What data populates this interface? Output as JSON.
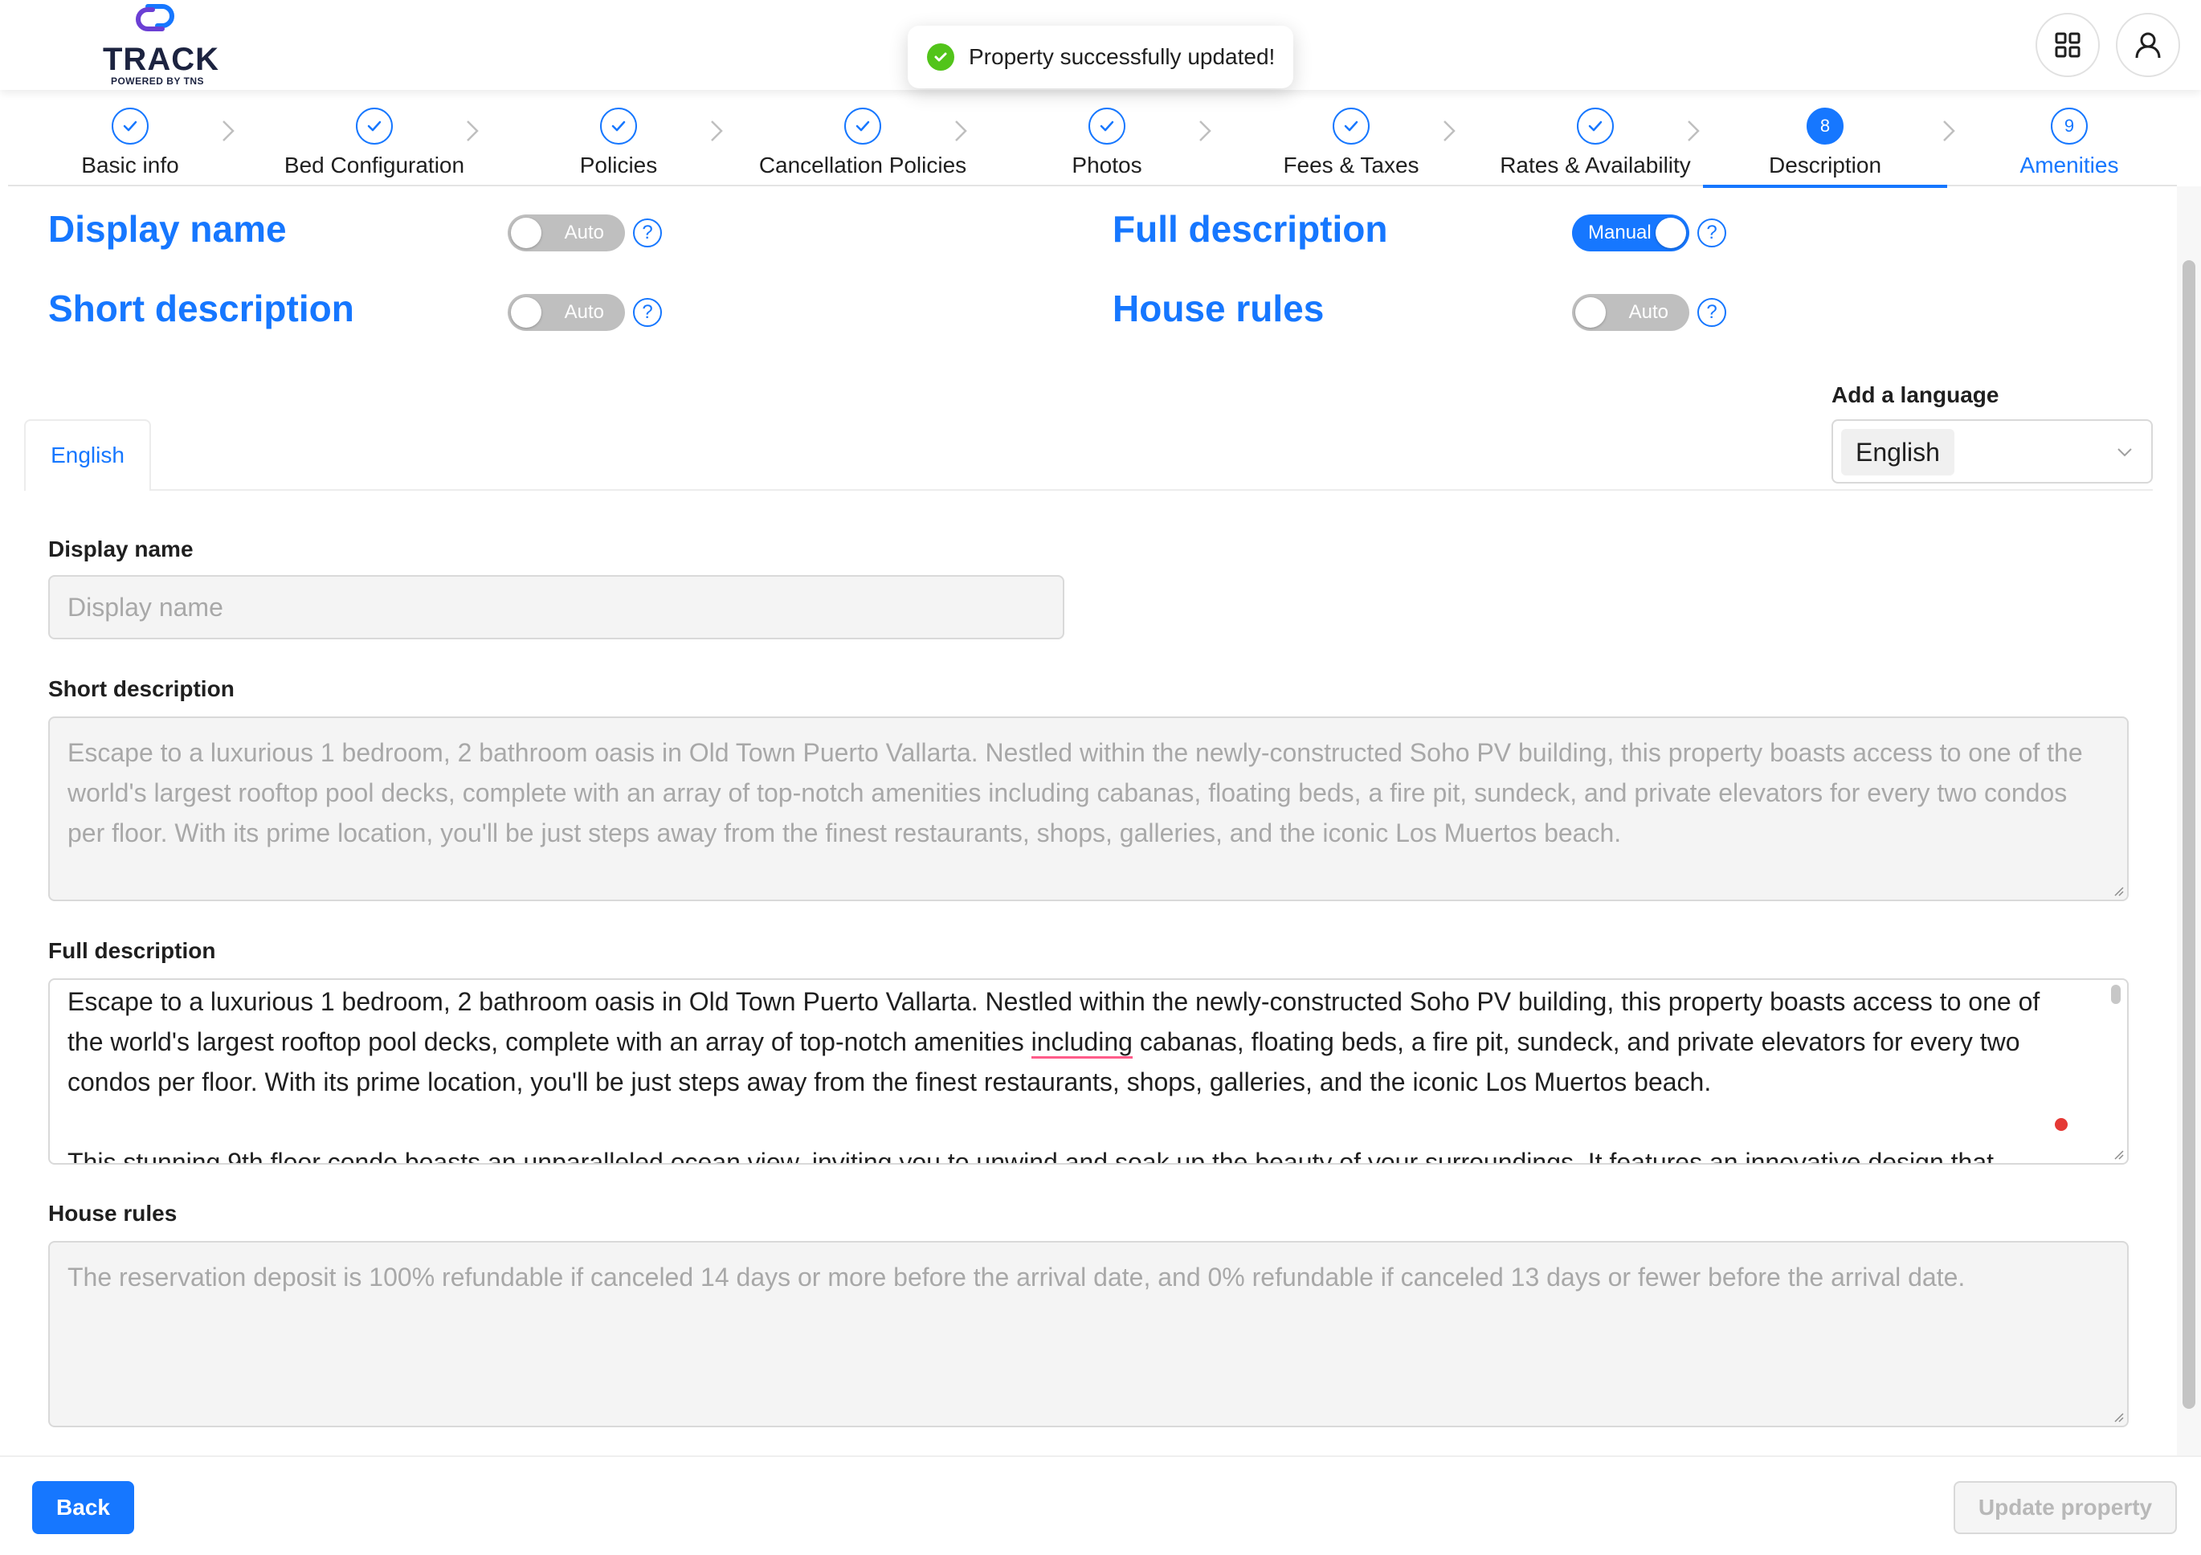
{
  "app": {
    "logo_text": "TRACK",
    "logo_subtext": "POWERED BY TNS",
    "accent_color": "#1677ff"
  },
  "header": {
    "apps_icon": "grid-icon",
    "user_icon": "user-icon"
  },
  "toast": {
    "message": "Property successfully updated!",
    "icon": "check-circle-icon",
    "color": "#52c41a"
  },
  "steps": [
    {
      "label": "Basic info",
      "state": "done"
    },
    {
      "label": "Bed Configuration",
      "state": "done"
    },
    {
      "label": "Policies",
      "state": "done"
    },
    {
      "label": "Cancellation Policies",
      "state": "done"
    },
    {
      "label": "Photos",
      "state": "done"
    },
    {
      "label": "Fees & Taxes",
      "state": "done"
    },
    {
      "label": "Rates & Availability",
      "state": "done"
    },
    {
      "label": "Description",
      "state": "active",
      "number": "8"
    },
    {
      "label": "Amenities",
      "state": "pending",
      "number": "9"
    }
  ],
  "sections": {
    "display_name": {
      "title": "Display name",
      "toggle": "Auto"
    },
    "short_description": {
      "title": "Short description",
      "toggle": "Auto"
    },
    "full_description": {
      "title": "Full description",
      "toggle": "Manual"
    },
    "house_rules": {
      "title": "House rules",
      "toggle": "Auto"
    },
    "help_symbol": "?"
  },
  "language": {
    "tab": "English",
    "add_label": "Add a language",
    "selected": "English"
  },
  "form": {
    "display_name": {
      "label": "Display name",
      "placeholder": "Display name",
      "value": ""
    },
    "short_description": {
      "label": "Short description",
      "value": "Escape to a luxurious 1 bedroom, 2 bathroom oasis in Old Town Puerto Vallarta. Nestled within the newly-constructed Soho PV building, this property boasts access to one of the world's largest rooftop pool decks, complete with an array of top-notch amenities including cabanas, floating beds, a fire pit, sundeck, and private elevators for every two condos per floor. With its prime location, you'll be just steps away from the finest restaurants, shops, galleries, and the iconic Los Muertos beach."
    },
    "full_description": {
      "label": "Full description",
      "para1_before": "Escape to a luxurious 1 bedroom, 2 bathroom oasis in Old Town Puerto Vallarta. Nestled within the newly-constructed Soho PV building, this property boasts access to one of the world's largest rooftop pool decks, complete with an array of top-notch amenities ",
      "para1_flagged": "including",
      "para1_after": " cabanas, floating beds, a fire pit, sundeck, and private elevators for every two condos per floor. With its prime location, you'll be just steps away from the finest restaurants, shops, galleries, and the iconic Los Muertos beach.",
      "para2": "This stunning 9th floor condo boasts an unparalleled ocean view, inviting you to unwind and soak up the beauty of your surroundings. It features an innovative design that"
    },
    "house_rules": {
      "label": "House rules",
      "value": "The reservation deposit is 100% refundable if canceled 14 days or more before the arrival date, and 0% refundable if canceled 13 days or fewer before the arrival date."
    }
  },
  "footer": {
    "back_label": "Back",
    "update_label": "Update property"
  }
}
